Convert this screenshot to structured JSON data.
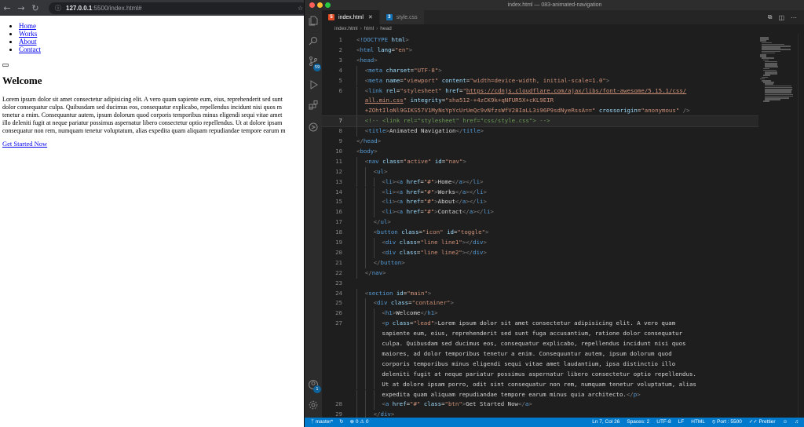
{
  "browser": {
    "url_host": "127.0.0.1",
    "url_path": ":5500/index.html#",
    "page": {
      "nav_items": [
        "Home",
        "Works",
        "About",
        "Contact"
      ],
      "heading": "Welcome",
      "lead_lines": [
        "Lorem ipsum dolor sit amet consectetur adipisicing elit. A vero quam sapiente eum, eius, reprehenderit sed sunt",
        "dolor consequatur culpa. Quibusdam sed ducimus eos, consequatur explicabo, repellendus incidunt nisi quos m",
        "tenetur a enim. Consequuntur autem, ipsum dolorum quod corporis temporibus minus eligendi sequi vitae amet",
        "illo deleniti fugit at neque pariatur possimus aspernatur libero consectetur optio repellendus. Ut at dolore ipsam",
        "consequatur non rem, numquam tenetur voluptatum, alias expedita quam aliquam repudiandae tempore earum m"
      ],
      "button_link": "Get Started Now"
    }
  },
  "vscode": {
    "window_title": "index.html — 083-animated-navigation",
    "tabs": [
      {
        "label": "index.html",
        "icon": "html5-icon",
        "active": true
      },
      {
        "label": "style.css",
        "icon": "css3-icon",
        "active": false
      }
    ],
    "breadcrumb": [
      "index.html",
      "html",
      "head"
    ],
    "activity_badges": {
      "source_control": "59",
      "accounts": "1"
    },
    "status": {
      "branch": "master*",
      "errors": "0",
      "warnings": "0",
      "position": "Ln 7, Col 26",
      "spaces": "Spaces: 2",
      "encoding": "UTF-8",
      "eol": "LF",
      "language": "HTML",
      "port": "Port : 5500",
      "formatter": "Prettier"
    },
    "colors": {
      "accent": "#007acc",
      "editor_bg": "#1e1e1e"
    }
  }
}
